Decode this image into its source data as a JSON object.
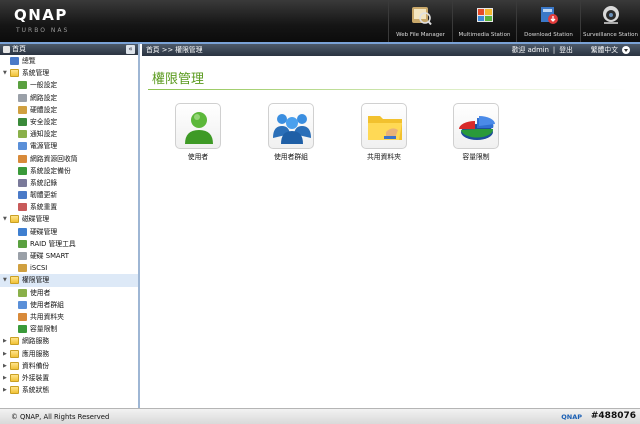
{
  "header": {
    "logo": "QNAP",
    "logo_sub": "TURBO NAS",
    "apps": [
      {
        "label": "Web File Manager",
        "icon": "web-file-manager-icon"
      },
      {
        "label": "Multimedia Station",
        "icon": "multimedia-station-icon"
      },
      {
        "label": "Download Station",
        "icon": "download-station-icon"
      },
      {
        "label": "Surveillance Station",
        "icon": "surveillance-station-icon"
      }
    ]
  },
  "sidebar": {
    "title": "首頁",
    "collapse": "«",
    "items": [
      {
        "label": "總覽",
        "level": 0,
        "type": "item"
      },
      {
        "label": "系統管理",
        "level": 0,
        "type": "folder",
        "expanded": true
      },
      {
        "label": "一般設定",
        "level": 1
      },
      {
        "label": "網路設定",
        "level": 1
      },
      {
        "label": "硬體設定",
        "level": 1
      },
      {
        "label": "安全設定",
        "level": 1
      },
      {
        "label": "通知設定",
        "level": 1
      },
      {
        "label": "電源管理",
        "level": 1
      },
      {
        "label": "網路資源回收筒",
        "level": 1
      },
      {
        "label": "系統設定備份",
        "level": 1
      },
      {
        "label": "系統記錄",
        "level": 1
      },
      {
        "label": "韌體更新",
        "level": 1
      },
      {
        "label": "系統重置",
        "level": 1
      },
      {
        "label": "磁碟管理",
        "level": 0,
        "type": "folder",
        "expanded": true
      },
      {
        "label": "硬碟管理",
        "level": 1
      },
      {
        "label": "RAID 管理工具",
        "level": 1
      },
      {
        "label": "硬碟 SMART",
        "level": 1
      },
      {
        "label": "iSCSI",
        "level": 1
      },
      {
        "label": "權限管理",
        "level": 0,
        "type": "folder",
        "expanded": true,
        "selected": true
      },
      {
        "label": "使用者",
        "level": 1
      },
      {
        "label": "使用者群組",
        "level": 1
      },
      {
        "label": "共用資料夾",
        "level": 1
      },
      {
        "label": "容量限制",
        "level": 1
      },
      {
        "label": "網路服務",
        "level": 0,
        "type": "folder",
        "expanded": false
      },
      {
        "label": "應用服務",
        "level": 0,
        "type": "folder",
        "expanded": false
      },
      {
        "label": "資料備份",
        "level": 0,
        "type": "folder",
        "expanded": false
      },
      {
        "label": "外接裝置",
        "level": 0,
        "type": "folder",
        "expanded": false
      },
      {
        "label": "系統狀態",
        "level": 0,
        "type": "folder",
        "expanded": false
      }
    ]
  },
  "crumbbar": {
    "breadcrumb": "首頁 >> 權限管理",
    "welcome": "歡迎 admin",
    "separator": "|",
    "logout": "登出",
    "language": "繁體中文"
  },
  "main": {
    "title": "權限管理",
    "tiles": [
      {
        "label": "使用者",
        "icon": "user-icon"
      },
      {
        "label": "使用者群組",
        "icon": "user-group-icon"
      },
      {
        "label": "共用資料夾",
        "icon": "shared-folder-icon"
      },
      {
        "label": "容量限制",
        "icon": "quota-pie-icon"
      }
    ]
  },
  "footer": {
    "copyright": "© QNAP, All Rights Reserved",
    "q_text": "QNAP",
    "tag": "#488076"
  },
  "colors": {
    "title_green": "#5a9a1e",
    "bar_dark": "#2a3340",
    "selection": "#dde9f7"
  }
}
